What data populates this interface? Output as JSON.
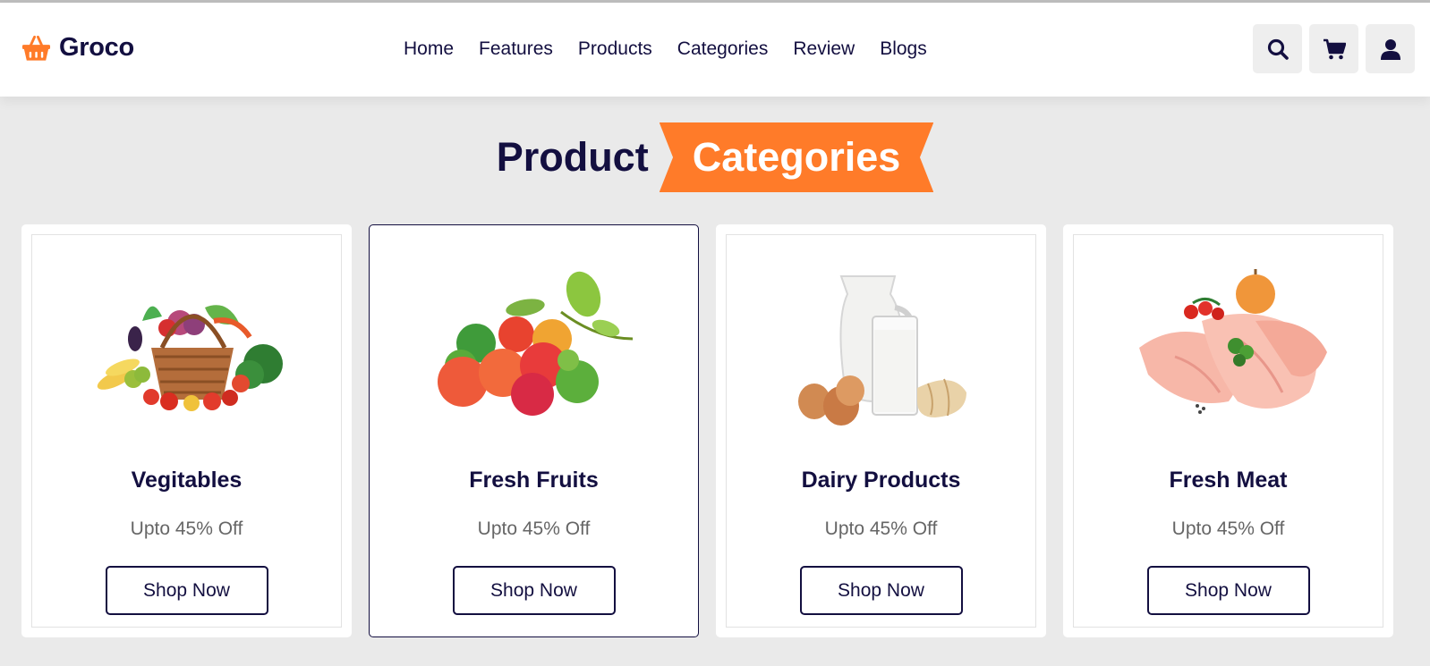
{
  "brand": {
    "name": "Groco",
    "logo_icon": "basket-icon",
    "accent": "#ff7b29",
    "dark": "#130f40"
  },
  "nav": [
    {
      "label": "Home"
    },
    {
      "label": "Features"
    },
    {
      "label": "Products"
    },
    {
      "label": "Categories"
    },
    {
      "label": "Review"
    },
    {
      "label": "Blogs"
    }
  ],
  "header_icons": [
    "search-icon",
    "cart-icon",
    "user-icon"
  ],
  "section": {
    "title_dark": "Product",
    "title_badge": "Categories"
  },
  "categories": [
    {
      "title": "Vegitables",
      "subtitle": "Upto 45% Off",
      "button": "Shop Now",
      "image": "vegetable-basket"
    },
    {
      "title": "Fresh Fruits",
      "subtitle": "Upto 45% Off",
      "button": "Shop Now",
      "image": "fresh-fruits"
    },
    {
      "title": "Dairy Products",
      "subtitle": "Upto 45% Off",
      "button": "Shop Now",
      "image": "milk-eggs-bread"
    },
    {
      "title": "Fresh Meat",
      "subtitle": "Upto 45% Off",
      "button": "Shop Now",
      "image": "chicken-meat"
    }
  ]
}
